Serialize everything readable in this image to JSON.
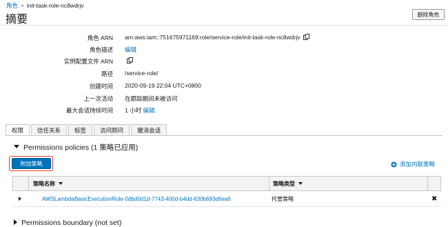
{
  "breadcrumb": {
    "parent": "角色",
    "separator": ">",
    "current": "init-task-role-nc8wdrjv"
  },
  "page": {
    "title": "摘要",
    "delete_button": "删除角色"
  },
  "summary": [
    {
      "label": "角色 ARN",
      "value": "arn:aws:iam::751675971169:role/service-role/init-task-role-nc8wdrjv",
      "copy": true
    },
    {
      "label": "角色描述",
      "link": "编辑"
    },
    {
      "label": "实例配置文件 ARN",
      "value": "",
      "copy": true
    },
    {
      "label": "路径",
      "value": "/service-role/"
    },
    {
      "label": "创建时间",
      "value": "2020-09-19 22:04 UTC+0800"
    },
    {
      "label": "上一次活动",
      "value": "在跟踪期间未被访问"
    },
    {
      "label": "最大会话持续时间",
      "value": "1 小时",
      "link": "编辑"
    }
  ],
  "tabs": [
    "权限",
    "信任关系",
    "标签",
    "访问顾问",
    "撤消会话"
  ],
  "permissions": {
    "section_title": "Permissions policies (1 策略已应用)",
    "attach_button": "附加策略",
    "add_inline": "添加内联策略",
    "columns": [
      "策略名称",
      "策略类型"
    ],
    "rows": [
      {
        "name": "AWSLambdaBasicExecutionRole-0dbd0d1d-7743-400d-b4dd-630b693d6ea6",
        "type": "托管策略",
        "remove": "✖"
      }
    ]
  },
  "boundary": {
    "title": "Permissions boundary (not set)"
  },
  "colors": {
    "link": "#0073bb",
    "primary": "#0073bb",
    "highlight": "#d93a2b"
  }
}
